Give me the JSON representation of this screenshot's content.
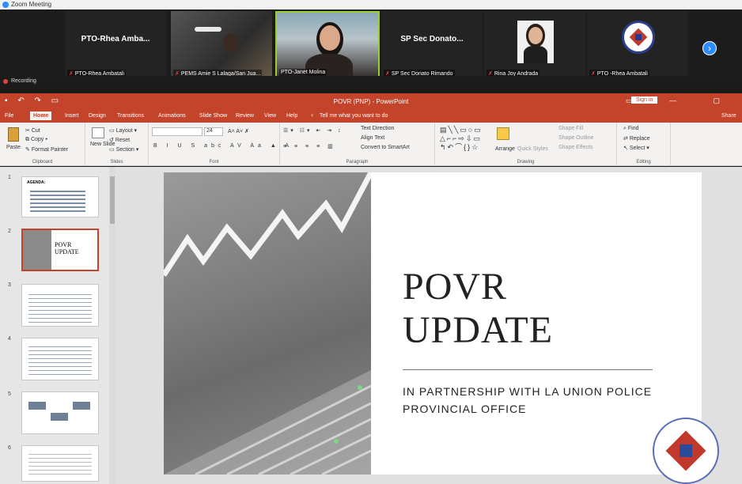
{
  "zoom": {
    "title": "Zoom Meeting",
    "recording": "Recording",
    "next_icon": "chevron-right-icon"
  },
  "participants": [
    {
      "big": "PTO-Rhea Amba...",
      "label": "PTO-Rhea Ambatali"
    },
    {
      "big": "",
      "label": "PEMS Amie S Lalaga/San Jua..."
    },
    {
      "big": "",
      "label": "PTO-Janet Molina"
    },
    {
      "big": "SP Sec Donato...",
      "label": "SP Sec Donato Rimando"
    },
    {
      "big": "",
      "label": "Rina Joy Andrada"
    },
    {
      "big": "",
      "label": "PTO -Rhea Ambatali"
    }
  ],
  "ppt": {
    "window_title": "POVR (PNP) - PowerPoint",
    "sign_in": "Sign in",
    "tabs": [
      "File",
      "Home",
      "Insert",
      "Design",
      "Transitions",
      "Animations",
      "Slide Show",
      "Review",
      "View",
      "Help"
    ],
    "tell_me": "Tell me what you want to do",
    "share": "Share",
    "ribbon": {
      "paste": "Paste",
      "cut": "Cut",
      "copy": "Copy",
      "format_painter": "Format Painter",
      "clipboard": "Clipboard",
      "new_slide": "New Slide",
      "layout": "Layout",
      "reset": "Reset",
      "section": "Section",
      "slides": "Slides",
      "font_size": "24",
      "font": "Font",
      "paragraph": "Paragraph",
      "text_direction": "Text Direction",
      "align_text": "Align Text",
      "smartart": "Convert to SmartArt",
      "arrange": "Arrange",
      "quick_styles": "Quick Styles",
      "shape_fill": "Shape Fill",
      "shape_outline": "Shape Outline",
      "shape_effects": "Shape Effects",
      "drawing": "Drawing",
      "find": "Find",
      "replace": "Replace",
      "select": "Select",
      "editing": "Editing"
    },
    "slides": [
      {
        "num": "1",
        "text": "AGENDA:"
      },
      {
        "num": "2",
        "text": "POVR UPDATE"
      },
      {
        "num": "3",
        "text": ""
      },
      {
        "num": "4",
        "text": ""
      },
      {
        "num": "5",
        "text": ""
      },
      {
        "num": "6",
        "text": ""
      }
    ],
    "current_slide": {
      "title": "POVR UPDATE",
      "subtitle": "IN PARTNERSHIP WITH LA UNION POLICE PROVINCIAL OFFICE"
    }
  },
  "colors": {
    "accent": "#c4432b",
    "zoom_blue": "#2d8cff"
  }
}
